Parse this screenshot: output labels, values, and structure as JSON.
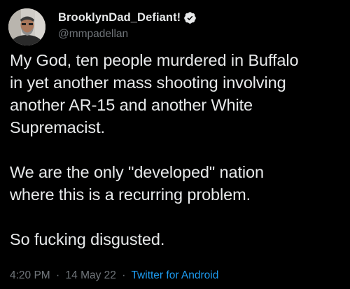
{
  "author": {
    "display_name": "BrooklynDad_Defiant!",
    "handle": "@mmpadellan",
    "verified": true,
    "verified_color": "#1d9bf0"
  },
  "tweet": {
    "lines": [
      "My God, ten people murdered in Buffalo",
      "in yet another mass shooting involving",
      "another AR-15 and another White",
      "Supremacist.",
      "",
      "We are the only \"developed\" nation",
      "where this is a recurring problem.",
      "",
      "So fucking disgusted."
    ]
  },
  "meta": {
    "time": "4:20 PM",
    "separator": "·",
    "date": "14 May 22",
    "source": "Twitter for Android"
  },
  "colors": {
    "background": "#000000",
    "text": "#e7e9ea",
    "secondary": "#71767b",
    "link": "#1d9bf0"
  }
}
